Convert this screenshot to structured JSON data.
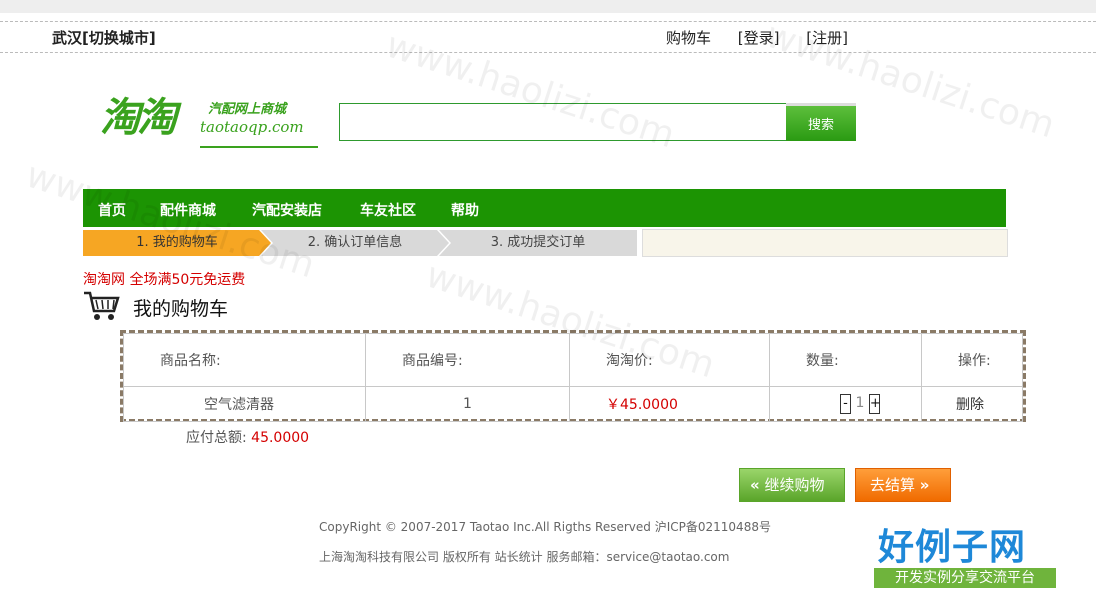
{
  "topbar": {
    "city": "武汉[切换城市]",
    "links": [
      "购物车",
      "[登录]",
      "[注册]"
    ]
  },
  "logo": {
    "main": "淘淘",
    "cn": "汽配网上商城",
    "en": "taotaoqp.com"
  },
  "search": {
    "value": "",
    "placeholder": "",
    "button": "搜索"
  },
  "nav": {
    "items": [
      "首页",
      "配件商城",
      "汽配安装店",
      "车友社区",
      "帮助"
    ]
  },
  "steps": [
    "1. 我的购物车",
    "2. 确认订单信息",
    "3. 成功提交订单"
  ],
  "promo": "淘淘网 全场满50元免运费",
  "cart": {
    "title": "我的购物车",
    "headers": [
      "商品名称:",
      "商品编号:",
      "淘淘价:",
      "数量:",
      "操作:"
    ],
    "rows": [
      {
        "name": "空气滤清器",
        "id": "1",
        "price": "￥45.0000",
        "qty": "1",
        "action": "删除"
      }
    ],
    "qty_minus": "-",
    "qty_plus": "+",
    "total_label": "应付总额:",
    "total_value": "45.0000"
  },
  "buttons": {
    "continue_label": "继续购物",
    "continue_icon": "«",
    "checkout_label": "去结算",
    "checkout_icon": "»"
  },
  "footer": {
    "line1": "CopyRight © 2007-2017 Taotao Inc.All Rigths Reserved 沪ICP备02110488号",
    "line2": "上海淘淘科技有限公司 版权所有 站长统计 服务邮箱：service@taotao.com"
  },
  "watermark": {
    "text": "www.haolizi.com",
    "brand": "好例子网",
    "brand_sub": "开发实例分享交流平台"
  },
  "colors": {
    "nav_green": "#1c9403",
    "step_active": "#f6a623",
    "price_red": "#d40000",
    "logo_green": "#3aa21e"
  }
}
